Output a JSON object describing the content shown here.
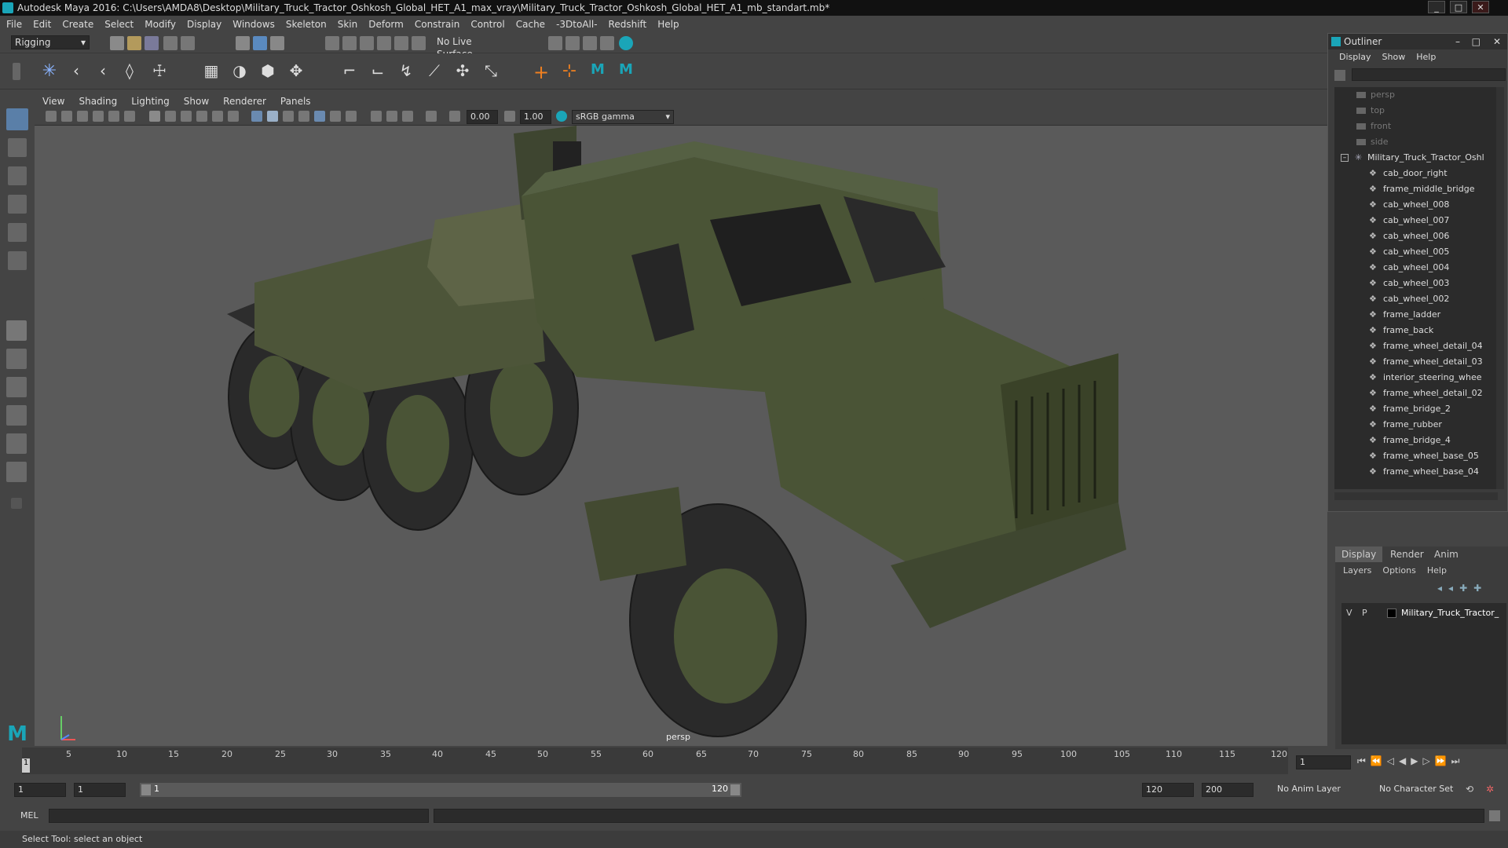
{
  "window": {
    "title": "Autodesk Maya 2016: C:\\Users\\AMDA8\\Desktop\\Military_Truck_Tractor_Oshkosh_Global_HET_A1_max_vray\\Military_Truck_Tractor_Oshkosh_Global_HET_A1_mb_standart.mb*"
  },
  "menus": [
    "File",
    "Edit",
    "Create",
    "Select",
    "Modify",
    "Display",
    "Windows",
    "Skeleton",
    "Skin",
    "Deform",
    "Constrain",
    "Control",
    "Cache",
    "-3DtoAll-",
    "Redshift",
    "Help"
  ],
  "statusline": {
    "mode": "Rigging",
    "live_surface": "No Live Surface"
  },
  "panel_menu": [
    "View",
    "Shading",
    "Lighting",
    "Show",
    "Renderer",
    "Panels"
  ],
  "panel_toolbar": {
    "exposure": "0.00",
    "gamma": "1.00",
    "colorspace": "sRGB gamma"
  },
  "viewport": {
    "camera_label": "persp"
  },
  "outliner": {
    "title": "Outliner",
    "menu": [
      "Display",
      "Show",
      "Help"
    ],
    "cameras": [
      "persp",
      "top",
      "front",
      "side"
    ],
    "root": "Military_Truck_Tractor_Oshl",
    "children": [
      "cab_door_right",
      "frame_middle_bridge",
      "cab_wheel_008",
      "cab_wheel_007",
      "cab_wheel_006",
      "cab_wheel_005",
      "cab_wheel_004",
      "cab_wheel_003",
      "cab_wheel_002",
      "frame_ladder",
      "frame_back",
      "frame_wheel_detail_04",
      "frame_wheel_detail_03",
      "interior_steering_whee",
      "frame_wheel_detail_02",
      "frame_bridge_2",
      "frame_rubber",
      "frame_bridge_4",
      "frame_wheel_base_05",
      "frame_wheel_base_04"
    ]
  },
  "layers": {
    "tabs": [
      "Display",
      "Render",
      "Anim"
    ],
    "menu": [
      "Layers",
      "Options",
      "Help"
    ],
    "row": {
      "v": "V",
      "p": "P",
      "name": "Military_Truck_Tractor_"
    }
  },
  "timeline": {
    "ticks": [
      "5",
      "10",
      "15",
      "20",
      "25",
      "30",
      "35",
      "40",
      "45",
      "50",
      "55",
      "60",
      "65",
      "70",
      "75",
      "80",
      "85",
      "90",
      "95",
      "100",
      "105",
      "110",
      "115",
      "120"
    ],
    "start_marker": "1",
    "current_frame": "1"
  },
  "range": {
    "start": "1",
    "inner_start": "1",
    "slider_start": "1",
    "slider_end": "120",
    "end": "120",
    "max": "200",
    "anim_layer": "No Anim Layer",
    "char_set": "No Character Set"
  },
  "mel": {
    "label": "MEL"
  },
  "help": {
    "text": "Select Tool: select an object"
  },
  "colors": {
    "accent": "#1aa5b8",
    "truck": "#4a5436",
    "viewport_bg": "#5a5a5a"
  }
}
